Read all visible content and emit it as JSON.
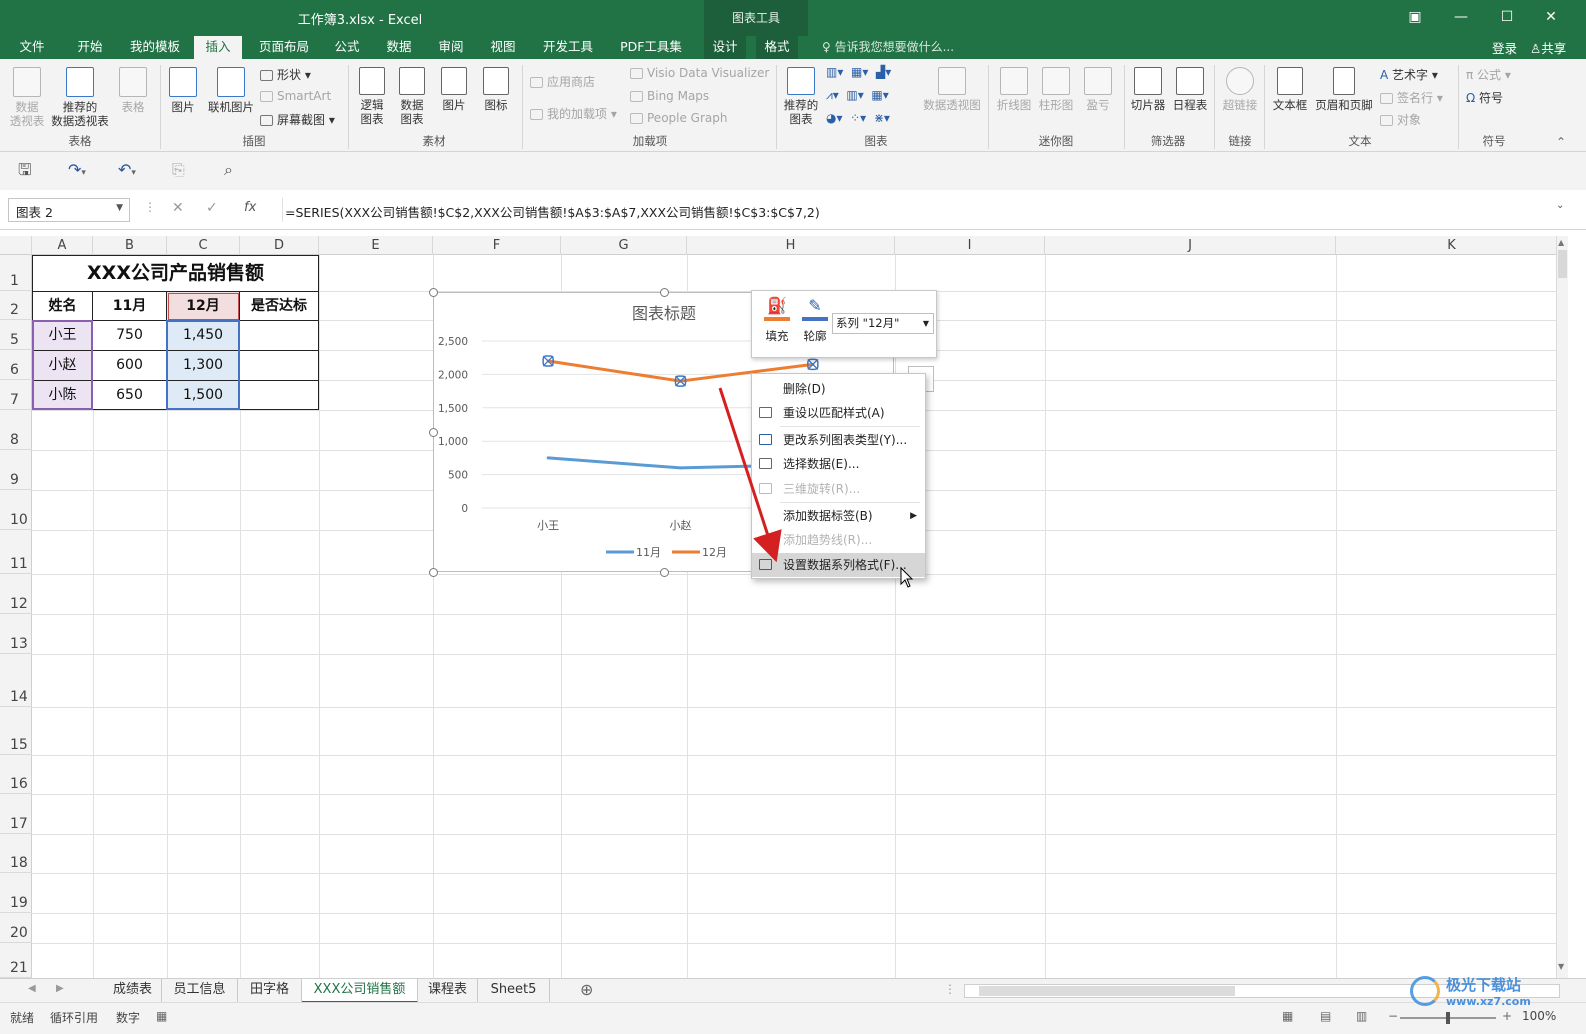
{
  "window": {
    "title": "工作簿3.xlsx - Excel",
    "context_tools": "图表工具"
  },
  "tabs": [
    "文件",
    "开始",
    "我的模板",
    "插入",
    "页面布局",
    "公式",
    "数据",
    "审阅",
    "视图",
    "开发工具",
    "PDF工具集",
    "设计",
    "格式"
  ],
  "active_tab": "插入",
  "tell_me": "告诉我您想要做什么...",
  "login": "登录",
  "share": "共享",
  "ribbon": {
    "table_group": {
      "pivot": "数据\n透视表",
      "recommended_pivot": "推荐的\n数据透视表",
      "table": "表格",
      "label": "表格"
    },
    "illustrations": {
      "picture": "图片",
      "online_picture": "联机图片",
      "shapes": "形状",
      "smartart": "SmartArt",
      "screenshot": "屏幕截图",
      "label": "插图"
    },
    "material": {
      "logic_chart": "逻辑\n图表",
      "data_chart": "数据\n图表",
      "picture": "图片",
      "icon": "图标",
      "label": "素材"
    },
    "addins": {
      "store": "应用商店",
      "my_addins": "我的加载项",
      "visio": "Visio Data Visualizer",
      "bing": "Bing Maps",
      "people": "People Graph",
      "label": "加载项"
    },
    "charts": {
      "recommended": "推荐的\n图表",
      "pivot_chart": "数据透视图",
      "label": "图表"
    },
    "sparklines": {
      "line": "折线图",
      "column": "柱形图",
      "winloss": "盈亏",
      "label": "迷你图"
    },
    "filters": {
      "slicer": "切片器",
      "timeline": "日程表",
      "label": "筛选器"
    },
    "links": {
      "hyperlink": "超链接",
      "label": "链接"
    },
    "text": {
      "textbox": "文本框",
      "header_footer": "页眉和页脚",
      "wordart": "艺术字",
      "signature": "签名行",
      "object": "对象",
      "label": "文本"
    },
    "symbols": {
      "equation": "公式",
      "symbol": "符号",
      "label": "符号"
    }
  },
  "formula_bar": {
    "name_box": "图表 2",
    "formula": "=SERIES(XXX公司销售额!$C$2,XXX公司销售额!$A$3:$A$7,XXX公司销售额!$C$3:$C$7,2)",
    "fx": "fx"
  },
  "columns": [
    "A",
    "B",
    "C",
    "D",
    "E",
    "F",
    "G",
    "H",
    "I",
    "J",
    "K"
  ],
  "rows": [
    "1",
    "2",
    "5",
    "6",
    "7",
    "8",
    "9",
    "10",
    "11",
    "12",
    "13",
    "14",
    "15",
    "16",
    "17",
    "18",
    "19",
    "20",
    "21"
  ],
  "sheet": {
    "title": "XXX公司产品销售额",
    "headers": [
      "姓名",
      "11月",
      "12月",
      "是否达标"
    ],
    "rows": [
      [
        "小王",
        "750",
        "1,450",
        ""
      ],
      [
        "小赵",
        "600",
        "1,300",
        ""
      ],
      [
        "小陈",
        "650",
        "1,500",
        ""
      ]
    ]
  },
  "chart_data": {
    "type": "line",
    "title": "图表标题",
    "categories": [
      "小王",
      "小赵",
      "小陈"
    ],
    "series": [
      {
        "name": "11月",
        "values": [
          750,
          600,
          650
        ],
        "color": "#5b9bd5"
      },
      {
        "name": "12月",
        "values": [
          2200,
          1900,
          2150
        ],
        "color": "#ed7d31"
      }
    ],
    "ylim": [
      0,
      2500
    ],
    "yticks": [
      "0",
      "500",
      "1,000",
      "1,500",
      "2,000",
      "2,500"
    ],
    "legend": "bottom"
  },
  "minibar": {
    "fill": "填充",
    "outline": "轮廓",
    "series_select": "系列 \"12月\""
  },
  "context_menu": [
    {
      "label": "删除(D)",
      "enabled": true
    },
    {
      "label": "重设以匹配样式(A)",
      "enabled": true
    },
    {
      "label": "更改系列图表类型(Y)...",
      "enabled": true
    },
    {
      "label": "选择数据(E)...",
      "enabled": true
    },
    {
      "label": "三维旋转(R)...",
      "enabled": false
    },
    {
      "label": "添加数据标签(B)",
      "enabled": true
    },
    {
      "label": "添加趋势线(R)...",
      "enabled": false
    },
    {
      "label": "设置数据系列格式(F)...",
      "enabled": true
    }
  ],
  "sheet_tabs": [
    "成绩表",
    "员工信息",
    "田字格",
    "XXX公司销售额",
    "课程表",
    "Sheet5"
  ],
  "active_sheet": "XXX公司销售额",
  "status": {
    "ready": "就绪",
    "circular": "循环引用",
    "num": "数字",
    "zoom": "100%"
  },
  "watermark": "极光下载站 www.xz7.com",
  "colors": {
    "excel_green": "#217346",
    "arrow_red": "#d42020"
  }
}
